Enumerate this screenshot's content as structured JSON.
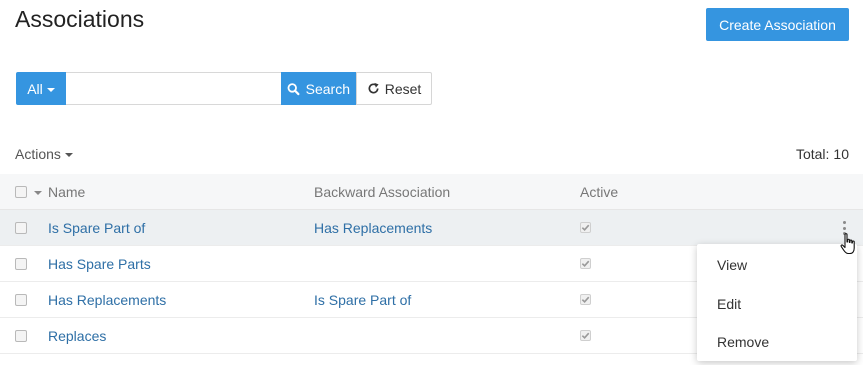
{
  "page": {
    "title": "Associations"
  },
  "header": {
    "create_label": "Create Association"
  },
  "search": {
    "scope_label": "All",
    "input_value": "",
    "search_label": "Search",
    "reset_label": "Reset"
  },
  "toolbar": {
    "actions_label": "Actions",
    "total_label": "Total:",
    "total_value": "10"
  },
  "table": {
    "columns": [
      "Name",
      "Backward Association",
      "Active"
    ],
    "rows": [
      {
        "name": "Is Spare Part of",
        "backward": "Has Replacements",
        "active": true
      },
      {
        "name": "Has Spare Parts",
        "backward": "",
        "active": true
      },
      {
        "name": "Has Replacements",
        "backward": "Is Spare Part of",
        "active": true
      },
      {
        "name": "Replaces",
        "backward": "",
        "active": true
      }
    ]
  },
  "row_menu": {
    "items": [
      "View",
      "Edit",
      "Remove"
    ]
  },
  "colors": {
    "accent": "#3595e0",
    "link": "#2e6fa6",
    "row_hover": "#edf0f2"
  }
}
